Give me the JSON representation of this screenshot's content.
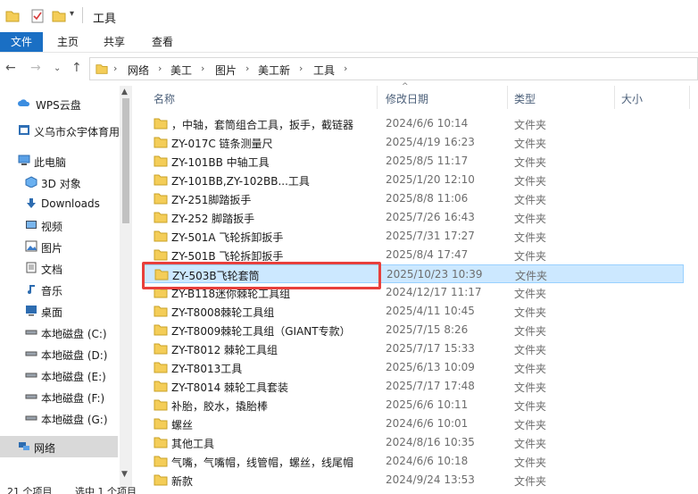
{
  "window": {
    "title": "工具"
  },
  "ribbon": {
    "tabs": [
      "文件",
      "主页",
      "共享",
      "查看"
    ]
  },
  "address": {
    "crumbs": [
      "网络",
      "美工",
      "图片",
      "美工新",
      "工具"
    ]
  },
  "sidebar": {
    "items": [
      {
        "label": "WPS云盘",
        "icon": "cloud-icon"
      },
      {
        "label": "义乌市众宇体育用",
        "icon": "app-icon"
      },
      {
        "label": "此电脑",
        "icon": "computer-icon"
      },
      {
        "label": "3D 对象",
        "icon": "cube-icon"
      },
      {
        "label": "Downloads",
        "icon": "download-icon"
      },
      {
        "label": "视频",
        "icon": "video-icon"
      },
      {
        "label": "图片",
        "icon": "picture-icon"
      },
      {
        "label": "文档",
        "icon": "document-icon"
      },
      {
        "label": "音乐",
        "icon": "music-icon"
      },
      {
        "label": "桌面",
        "icon": "desktop-icon"
      },
      {
        "label": "本地磁盘 (C:)",
        "icon": "drive-icon"
      },
      {
        "label": "本地磁盘 (D:)",
        "icon": "drive-icon"
      },
      {
        "label": "本地磁盘 (E:)",
        "icon": "drive-icon"
      },
      {
        "label": "本地磁盘 (F:)",
        "icon": "drive-icon"
      },
      {
        "label": "本地磁盘 (G:)",
        "icon": "drive-icon"
      },
      {
        "label": "网络",
        "icon": "network-icon"
      }
    ]
  },
  "columns": {
    "name": "名称",
    "date": "修改日期",
    "type": "类型",
    "size": "大小"
  },
  "files": [
    {
      "name": "，中轴，套筒组合工具，扳手，截链器",
      "date": "2024/6/6 10:14",
      "type": "文件夹"
    },
    {
      "name": "ZY-017C  链条测量尺",
      "date": "2025/4/19 16:23",
      "type": "文件夹"
    },
    {
      "name": "ZY-101BB  中轴工具",
      "date": "2025/8/5 11:17",
      "type": "文件夹"
    },
    {
      "name": "ZY-101BB,ZY-102BB...工具",
      "date": "2025/1/20 12:10",
      "type": "文件夹"
    },
    {
      "name": "ZY-251脚踏扳手",
      "date": "2025/8/8 11:06",
      "type": "文件夹"
    },
    {
      "name": "ZY-252 脚踏扳手",
      "date": "2025/7/26 16:43",
      "type": "文件夹"
    },
    {
      "name": "ZY-501A  飞轮拆卸扳手",
      "date": "2025/7/31 17:27",
      "type": "文件夹"
    },
    {
      "name": "ZY-501B  飞轮拆卸扳手",
      "date": "2025/8/4 17:47",
      "type": "文件夹"
    },
    {
      "name": "ZY-503B飞轮套筒",
      "date": "2025/10/23 10:39",
      "type": "文件夹"
    },
    {
      "name": "ZY-B118迷你棘轮工具组",
      "date": "2024/12/17 11:17",
      "type": "文件夹"
    },
    {
      "name": "ZY-T8008棘轮工具组",
      "date": "2025/4/11 10:45",
      "type": "文件夹"
    },
    {
      "name": "ZY-T8009棘轮工具组（GIANT专款）",
      "date": "2025/7/15 8:26",
      "type": "文件夹"
    },
    {
      "name": "ZY-T8012 棘轮工具组",
      "date": "2025/7/17 15:33",
      "type": "文件夹"
    },
    {
      "name": "ZY-T8013工具",
      "date": "2025/6/13 10:09",
      "type": "文件夹"
    },
    {
      "name": "ZY-T8014 棘轮工具套装",
      "date": "2025/7/17 17:48",
      "type": "文件夹"
    },
    {
      "name": "补胎，胶水，撬胎棒",
      "date": "2025/6/6 10:11",
      "type": "文件夹"
    },
    {
      "name": "螺丝",
      "date": "2024/6/6 10:01",
      "type": "文件夹"
    },
    {
      "name": "其他工具",
      "date": "2024/8/16 10:35",
      "type": "文件夹"
    },
    {
      "name": "气嘴，气嘴帽，线管帽，螺丝，线尾帽",
      "date": "2024/6/6 10:18",
      "type": "文件夹"
    },
    {
      "name": "新款",
      "date": "2024/9/24 13:53",
      "type": "文件夹"
    }
  ],
  "selected_index": 8,
  "status": {
    "count": "21 个项目",
    "selected": "选中 1 个项目"
  },
  "colors": {
    "accent": "#1a6fc4",
    "selection": "#cce8ff",
    "highlight_box": "#e8403c",
    "folder": "#f4cd58"
  }
}
